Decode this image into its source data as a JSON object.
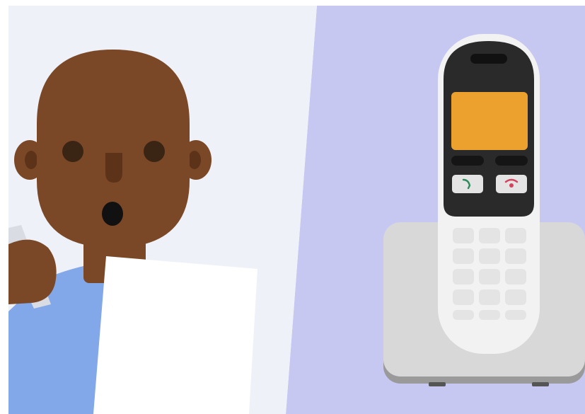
{
  "scene": {
    "colors": {
      "left_background": "#EEF1F8",
      "right_background": "#C7C8F2",
      "skin": "#7A4826",
      "skin_shadow": "#5C3318",
      "eye": "#3A2414",
      "mouth": "#111111",
      "shirt": "#82A8E9",
      "paper": "#FFFFFF",
      "phone_shell": "#F2F2F2",
      "phone_face": "#2A2A2A",
      "phone_screen": "#ECA02E",
      "key": "#E4E4E4",
      "base": "#D8D8D8",
      "base_shadow": "#9A9A9A",
      "call_green": "#2E8A5B",
      "call_red": "#D6425C"
    },
    "icons": {
      "call_button": "phone-answer-icon",
      "end_button": "phone-hangup-icon"
    },
    "keypad": {
      "rows": 5,
      "columns": 3
    }
  }
}
